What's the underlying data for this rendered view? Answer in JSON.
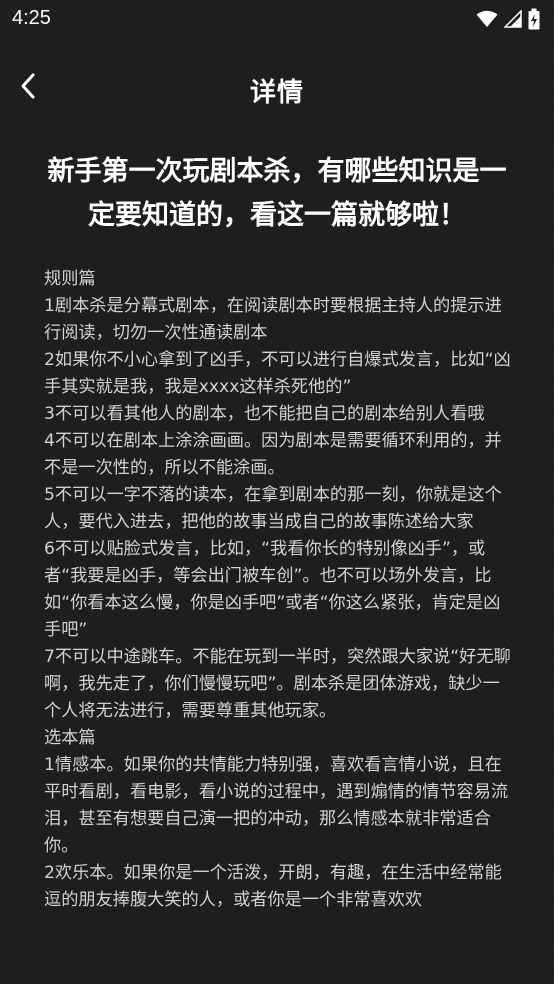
{
  "status_bar": {
    "time": "4:25",
    "icons": [
      "wifi-icon",
      "cellular-signal-icon",
      "battery-charging-icon"
    ]
  },
  "app_bar": {
    "back_icon": "chevron-left-icon",
    "title": "详情"
  },
  "article": {
    "title": "新手第一次玩剧本杀，有哪些知识是一定要知道的，看这一篇就够啦！",
    "paragraphs": [
      "规则篇",
      "1剧本杀是分幕式剧本，在阅读剧本时要根据主持人的提示进行阅读，切勿一次性通读剧本",
      "2如果你不小心拿到了凶手，不可以进行自爆式发言，比如“凶手其实就是我，我是xxxx这样杀死他的”",
      "3不可以看其他人的剧本，也不能把自己的剧本给别人看哦",
      "4不可以在剧本上涂涂画画。因为剧本是需要循环利用的，并不是一次性的，所以不能涂画。",
      "5不可以一字不落的读本，在拿到剧本的那一刻，你就是这个人，要代入进去，把他的故事当成自己的故事陈述给大家",
      "6不可以贴脸式发言，比如，“我看你长的特别像凶手”，或者“我要是凶手，等会出门被车创”。也不可以场外发言，比如“你看本这么慢，你是凶手吧”或者“你这么紧张，肯定是凶手吧”",
      "7不可以中途跳车。不能在玩到一半时，突然跟大家说“好无聊啊，我先走了，你们慢慢玩吧”。剧本杀是团体游戏，缺少一个人将无法进行，需要尊重其他玩家。",
      "选本篇",
      "1情感本。如果你的共情能力特别强，喜欢看言情小说，且在平时看剧，看电影，看小说的过程中，遇到煽情的情节容易流泪，甚至有想要自己演一把的冲动，那么情感本就非常适合你。",
      "2欢乐本。如果你是一个活泼，开朗，有趣，在生活中经常能逗的朋友捧腹大笑的人，或者你是一个非常喜欢欢"
    ]
  }
}
